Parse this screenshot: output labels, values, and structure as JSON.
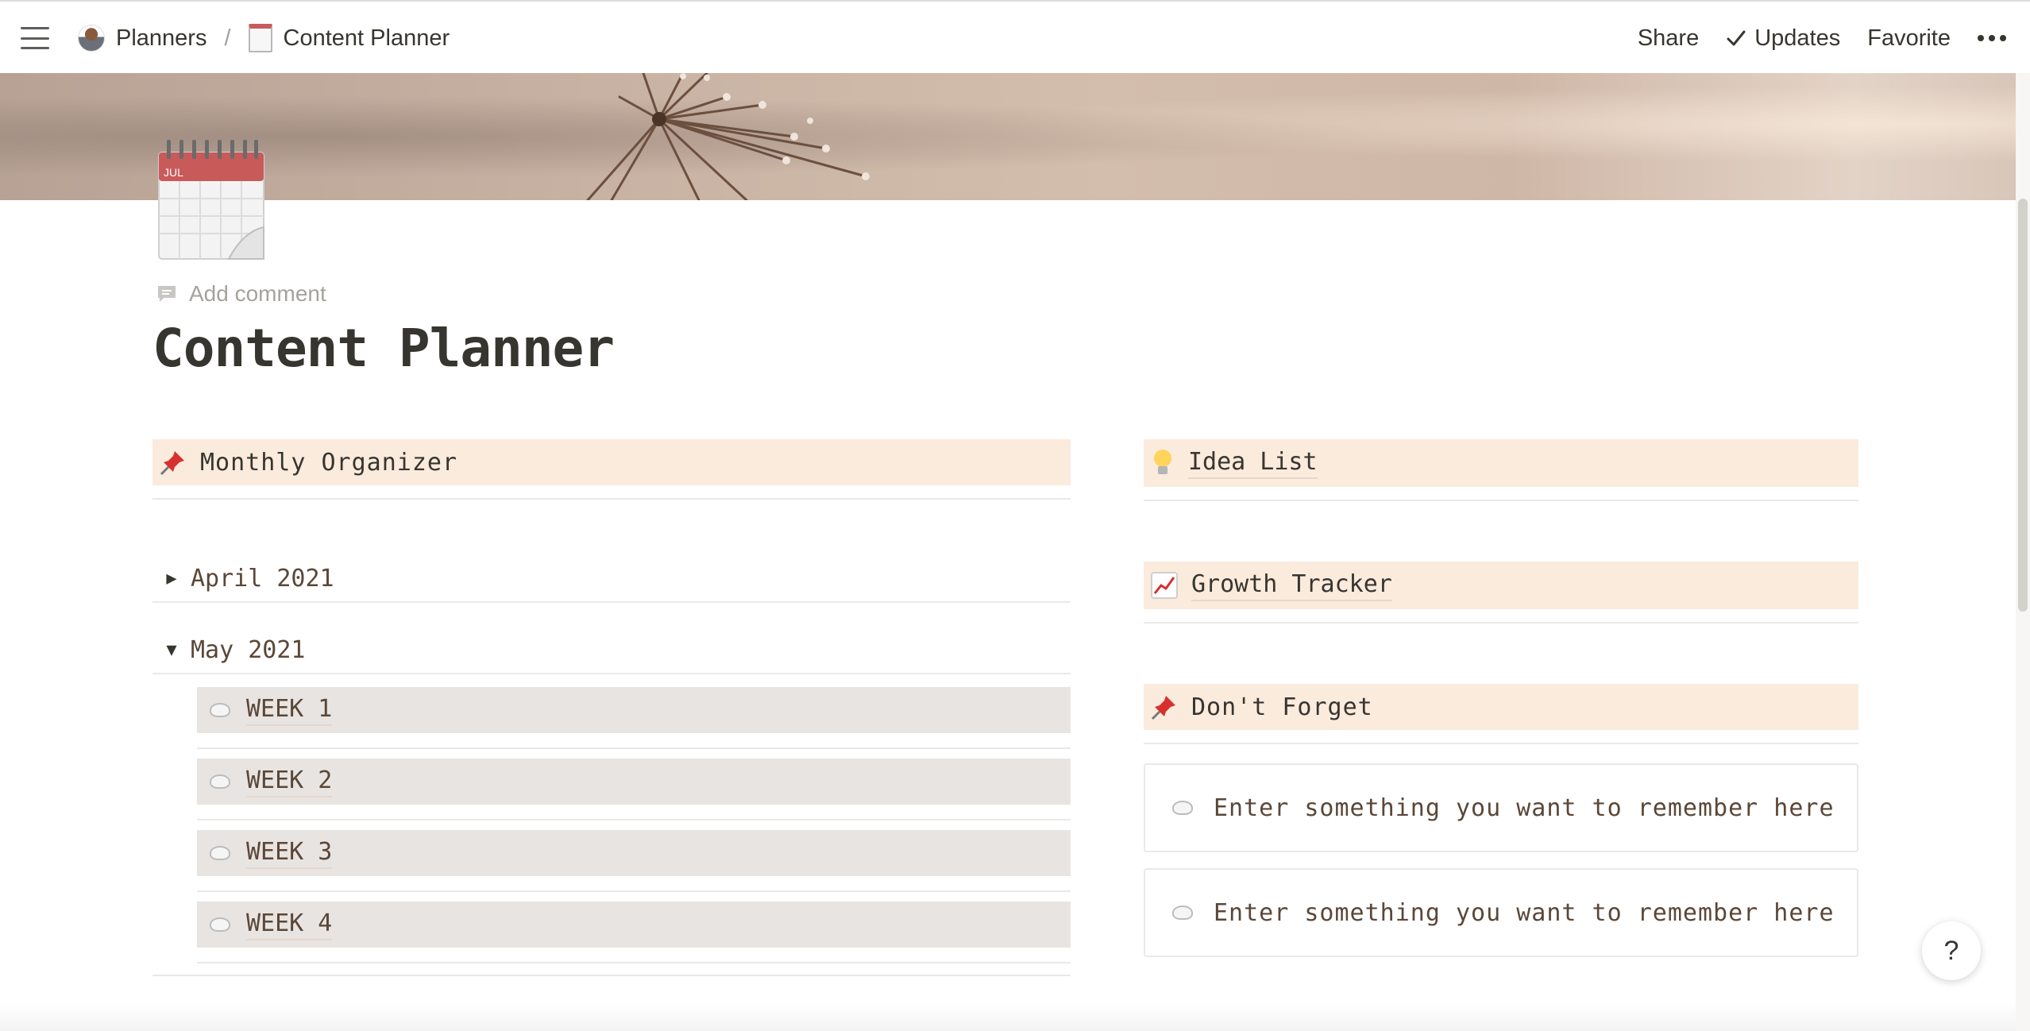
{
  "breadcrumb": {
    "parent": "Planners",
    "separator": "/",
    "current": "Content Planner",
    "parent_icon": "person-at-laptop-icon",
    "current_icon": "notepad-icon"
  },
  "topbar": {
    "share": "Share",
    "updates": "Updates",
    "favorite": "Favorite"
  },
  "page": {
    "icon": "calendar-icon",
    "icon_month": "JUL",
    "add_comment": "Add comment",
    "title": "Content Planner"
  },
  "left": {
    "header": "Monthly Organizer",
    "header_icon": "pushpin-icon",
    "months": [
      {
        "label": "April 2021",
        "state": "collapsed"
      },
      {
        "label": "May 2021",
        "state": "expanded"
      }
    ],
    "weeks": [
      "WEEK 1",
      "WEEK 2",
      "WEEK 3",
      "WEEK 4"
    ]
  },
  "right": {
    "idea_list": "Idea List",
    "growth_tracker": "Growth Tracker",
    "dont_forget": "Don't Forget",
    "reminders": [
      "Enter something you want to remember here",
      "Enter something you want to remember here"
    ]
  },
  "help": "?",
  "colors": {
    "callout_bg": "#fbebdd",
    "week_bg": "#e8e4e1",
    "text_brown": "#5b4738"
  }
}
